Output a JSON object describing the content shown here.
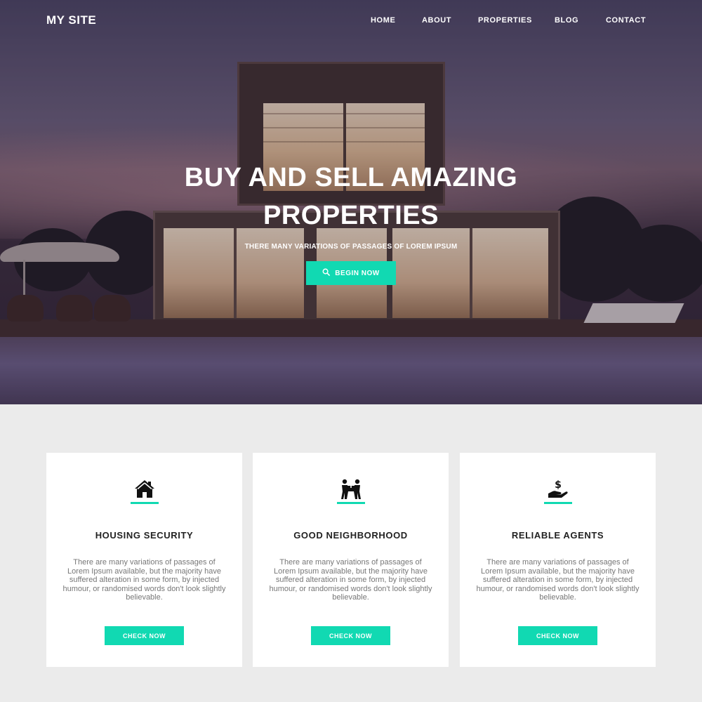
{
  "nav": {
    "logo": "MY SITE",
    "items": [
      {
        "label": "HOME"
      },
      {
        "label": "ABOUT"
      },
      {
        "label": "PROPERTIES"
      },
      {
        "label": "BLOG"
      },
      {
        "label": "CONTACT"
      }
    ]
  },
  "hero": {
    "title_line1": "BUY AND SELL AMAZING",
    "title_line2": "PROPERTIES",
    "subtitle": "THERE MANY VARIATIONS OF PASSAGES OF LOREM IPSUM",
    "cta_label": "BEGIN NOW",
    "cta_icon": "search-icon"
  },
  "features": [
    {
      "icon": "house-icon",
      "title": "HOUSING SECURITY",
      "text": "There are many variations of passages of Lorem Ipsum available, but the majority have suffered alteration in some form, by injected humour, or randomised words don't look slightly believable.",
      "button": "CHECK NOW"
    },
    {
      "icon": "people-carrying-box-icon",
      "title": "GOOD NEIGHBORHOOD",
      "text": "There are many variations of passages of Lorem Ipsum available, but the majority have suffered alteration in some form, by injected humour, or randomised words don't look slightly believable.",
      "button": "CHECK NOW"
    },
    {
      "icon": "hand-holding-dollar-icon",
      "title": "RELIABLE AGENTS",
      "text": "There are many variations of passages of Lorem Ipsum available, but the majority have suffered alteration in some form, by injected humour, or randomised words don't look slightly believable.",
      "button": "CHECK NOW"
    }
  ],
  "colors": {
    "accent": "#11d9b2",
    "section_bg": "#ebebeb",
    "card_bg": "#ffffff",
    "heading": "#222222",
    "body_text": "#777777"
  }
}
